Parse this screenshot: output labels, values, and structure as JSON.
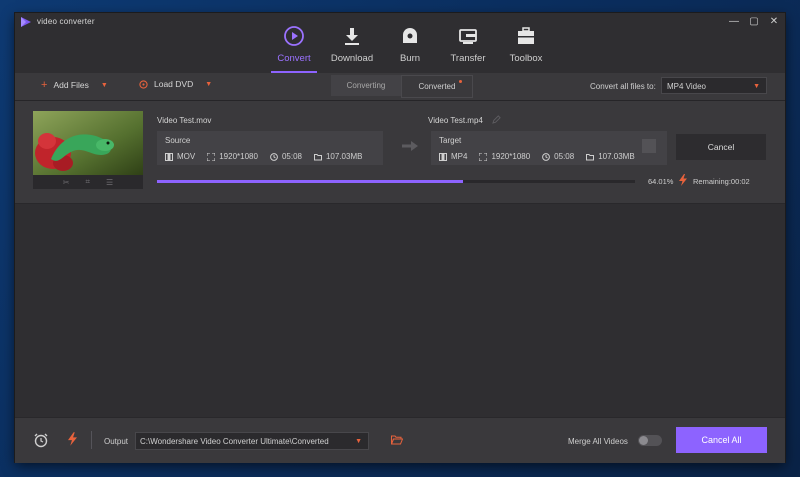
{
  "app": {
    "title": "video converter"
  },
  "window_controls": {
    "minimize": "—",
    "restore": "▢",
    "close": "✕"
  },
  "nav": {
    "tabs": [
      {
        "label": "Convert",
        "icon": "play-circle-icon",
        "active": true
      },
      {
        "label": "Download",
        "icon": "download-icon",
        "active": false
      },
      {
        "label": "Burn",
        "icon": "disc-icon",
        "active": false
      },
      {
        "label": "Transfer",
        "icon": "transfer-icon",
        "active": false
      },
      {
        "label": "Toolbox",
        "icon": "toolbox-icon",
        "active": false
      }
    ]
  },
  "toolbar": {
    "add_files": "Add Files",
    "load_dvd": "Load DVD",
    "segments": {
      "converting": "Converting",
      "converted": "Converted"
    },
    "convert_all_label": "Convert all files to:",
    "convert_all_value": "MP4 Video"
  },
  "item": {
    "source_name": "Video Test.mov",
    "target_name": "Video Test.mp4",
    "source": {
      "header": "Source",
      "format": "MOV",
      "resolution": "1920*1080",
      "duration": "05:08",
      "size": "107.03MB"
    },
    "target": {
      "header": "Target",
      "format": "MP4",
      "resolution": "1920*1080",
      "duration": "05:08",
      "size": "107.03MB"
    },
    "cancel_label": "Cancel",
    "progress_pct_value": 64.01,
    "progress_text": "64.01%",
    "remaining_text": "Remaining:00:02"
  },
  "footer": {
    "output_label": "Output",
    "output_path": "C:\\Wondershare Video Converter Ultimate\\Converted",
    "merge_label": "Merge All Videos",
    "merge_enabled": false,
    "cancel_all": "Cancel All"
  },
  "colors": {
    "accent": "#8d63ff",
    "orange": "#e8623c",
    "window_bg": "#2f2e31",
    "panel_bg": "#3a393c"
  }
}
